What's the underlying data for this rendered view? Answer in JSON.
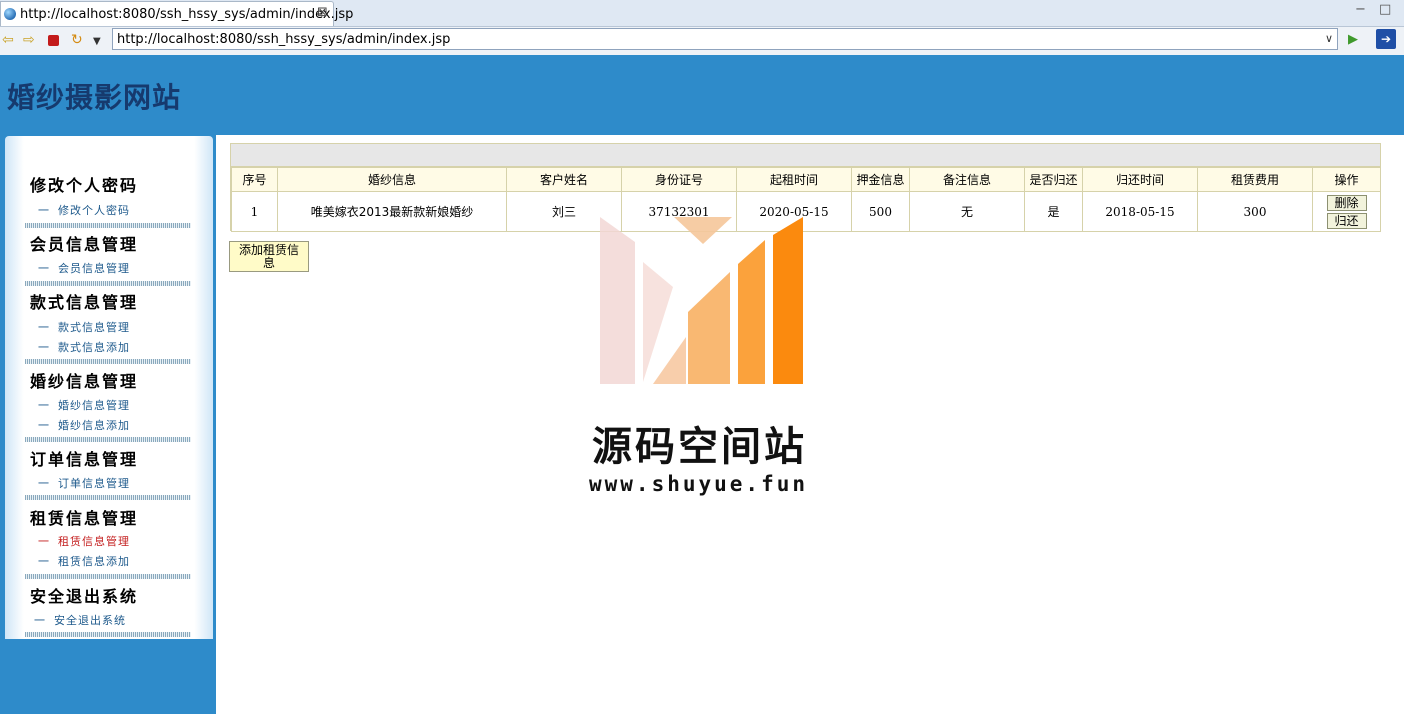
{
  "browser": {
    "tab_title": "http://localhost:8080/ssh_hssy_sys/admin/index.jsp",
    "tab_close": "⊠",
    "address_url": "http://localhost:8080/ssh_hssy_sys/admin/index.jsp",
    "icons": [
      "globe-icon",
      "back-icon",
      "forward-icon",
      "stop-icon",
      "refresh-icon",
      "menu-dropdown-icon",
      "go-icon",
      "external-browser-icon"
    ]
  },
  "site": {
    "title": "婚纱摄影网站",
    "header_color": "#2e8bca"
  },
  "sidebar": {
    "sections": [
      {
        "heading": "修改个人密码",
        "items": [
          {
            "label": "修改个人密码",
            "active": false
          }
        ]
      },
      {
        "heading": "会员信息管理",
        "items": [
          {
            "label": "会员信息管理",
            "active": false
          }
        ]
      },
      {
        "heading": "款式信息管理",
        "items": [
          {
            "label": "款式信息管理",
            "active": false
          },
          {
            "label": "款式信息添加",
            "active": false
          }
        ]
      },
      {
        "heading": "婚纱信息管理",
        "items": [
          {
            "label": "婚纱信息管理",
            "active": false
          },
          {
            "label": "婚纱信息添加",
            "active": false
          }
        ]
      },
      {
        "heading": "订单信息管理",
        "items": [
          {
            "label": "订单信息管理",
            "active": false
          }
        ]
      },
      {
        "heading": "租赁信息管理",
        "items": [
          {
            "label": "租赁信息管理",
            "active": true
          },
          {
            "label": "租赁信息添加",
            "active": false
          }
        ]
      },
      {
        "heading": "安全退出系统",
        "items": [
          {
            "label": "安全退出系统",
            "active": false
          }
        ]
      }
    ],
    "item_prefix": "一",
    "active_color": "#c42020"
  },
  "table": {
    "columns": [
      "序号",
      "婚纱信息",
      "客户姓名",
      "身份证号",
      "起租时间",
      "押金信息",
      "备注信息",
      "是否归还",
      "归还时间",
      "租赁费用",
      "操作"
    ],
    "rows": [
      {
        "index": "1",
        "dress": "唯美嫁衣2013最新款新娘婚纱",
        "customer": "刘三",
        "id_number": "37132301",
        "start_date": "2020-05-15",
        "deposit": "500",
        "remark": "无",
        "returned": "是",
        "return_date": "2018-05-15",
        "fee": "300",
        "actions": {
          "delete": "删除",
          "return": "归还"
        }
      }
    ]
  },
  "add_button_label": "添加租赁信息",
  "watermark": {
    "title": "源码空间站",
    "url": "www.shuyue.fun"
  }
}
